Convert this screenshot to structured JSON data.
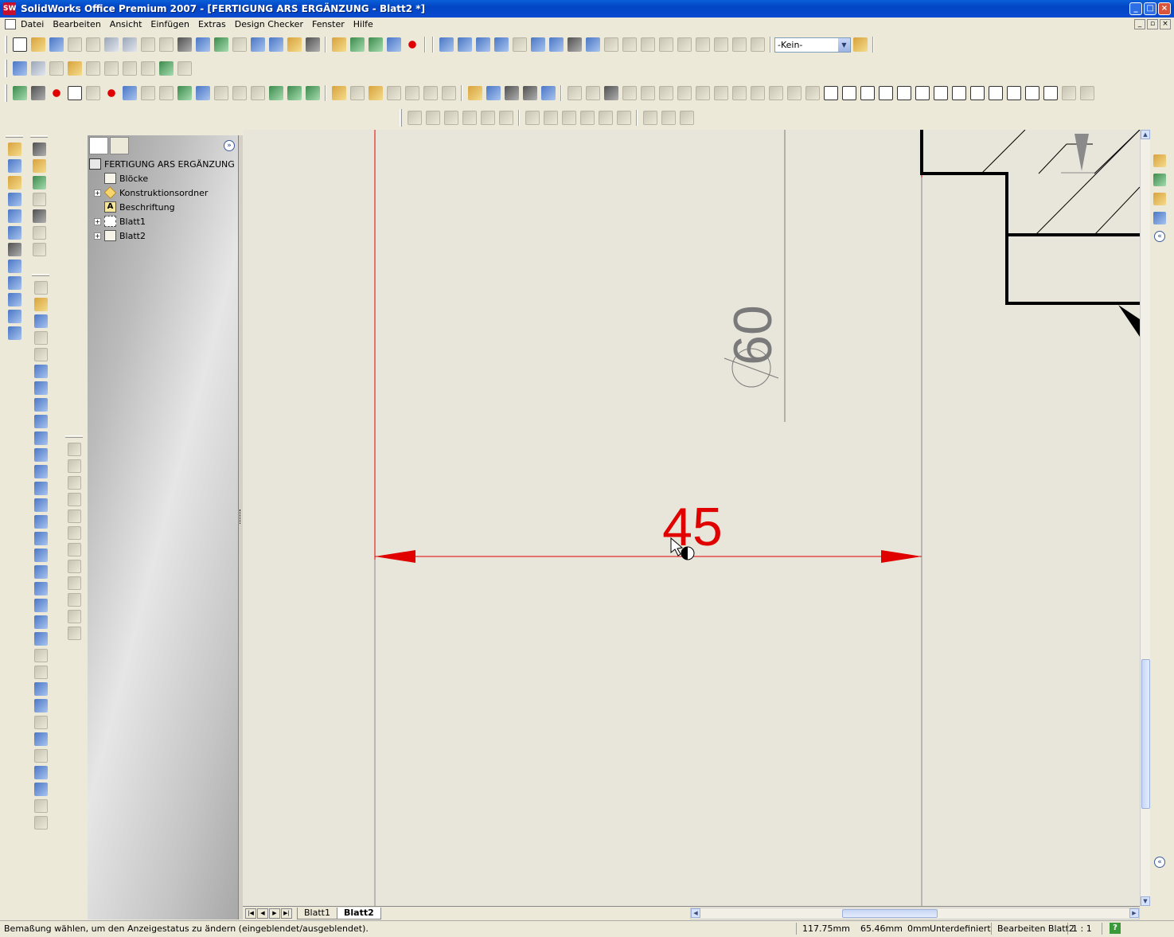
{
  "window": {
    "title": "SolidWorks Office Premium 2007 - [FERTIGUNG ARS ERGÄNZUNG - Blatt2 *]",
    "app_icon_label": "SW"
  },
  "menubar": {
    "items": [
      "Datei",
      "Bearbeiten",
      "Ansicht",
      "Einfügen",
      "Extras",
      "Design Checker",
      "Fenster",
      "Hilfe"
    ]
  },
  "toolbar": {
    "layer_dropdown": "-Kein-"
  },
  "feature_manager": {
    "root": "FERTIGUNG ARS ERGÄNZUNG",
    "items": [
      {
        "label": "Blöcke",
        "expandable": false,
        "icon": "blocks-icon"
      },
      {
        "label": "Konstruktionsordner",
        "expandable": true,
        "icon": "folder-diamond-icon"
      },
      {
        "label": "Beschriftung",
        "expandable": false,
        "icon": "annotation-icon"
      },
      {
        "label": "Blatt1",
        "expandable": true,
        "icon": "sheet-inactive-icon"
      },
      {
        "label": "Blatt2",
        "expandable": true,
        "icon": "sheet-icon"
      }
    ]
  },
  "drawing": {
    "dimension_selected": "45",
    "dimension_diameter": "60",
    "dimension_selected_color": "#e00000",
    "dimension_gray_color": "#7a7a7a",
    "sheet_color": "#e8e6da"
  },
  "sheets": {
    "tabs": [
      "Blatt1",
      "Blatt2"
    ],
    "active": "Blatt2"
  },
  "statusbar": {
    "message": "Bemaßung wählen, um den Anzeigestatus zu ändern  (eingeblendet/ausgeblendet).",
    "x": "117.75mm",
    "y": "65.46mm",
    "z": "0mm",
    "state": "Unterdefiniert",
    "mode": "Bearbeiten Blatt2",
    "scale": "1 : 1"
  }
}
